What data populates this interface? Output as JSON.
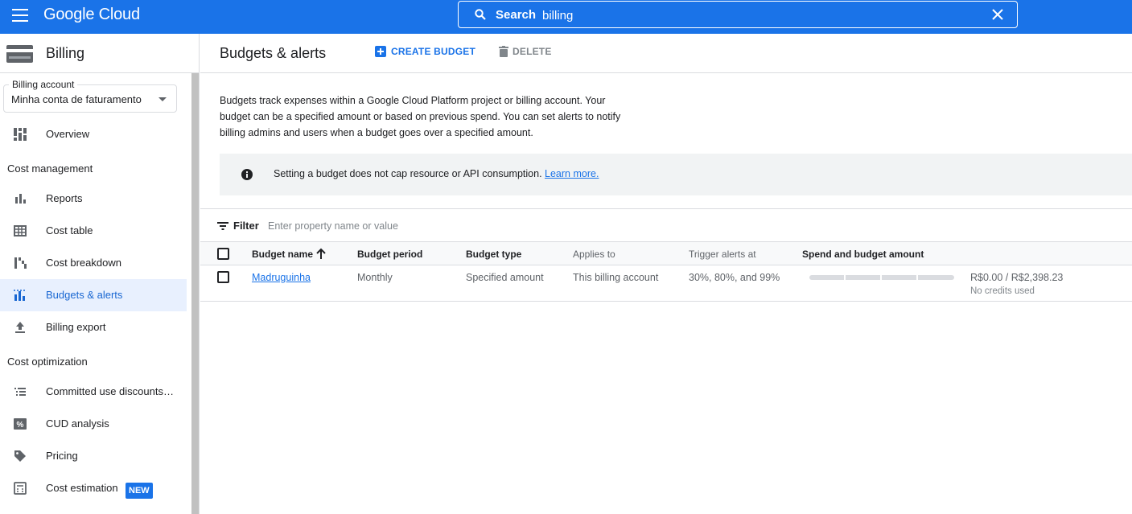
{
  "topbar": {
    "logo": "Google Cloud",
    "search_label": "Search",
    "search_value": "billing"
  },
  "sidebar": {
    "title": "Billing",
    "billing_account": {
      "legend": "Billing account",
      "value": "Minha conta de faturamento"
    },
    "overview": "Overview",
    "sections": {
      "cost_management": "Cost management",
      "cost_optimization": "Cost optimization"
    },
    "items": {
      "reports": "Reports",
      "cost_table": "Cost table",
      "cost_breakdown": "Cost breakdown",
      "budgets_alerts": "Budgets & alerts",
      "billing_export": "Billing export",
      "committed_use": "Committed use discounts…",
      "cud_analysis": "CUD analysis",
      "pricing": "Pricing",
      "cost_estimation": "Cost estimation"
    },
    "new_badge": "NEW",
    "active_item": "Budgets & alerts"
  },
  "main": {
    "title": "Budgets & alerts",
    "create_button": "CREATE BUDGET",
    "delete_button": "DELETE",
    "description": "Budgets track expenses within a Google Cloud Platform project or billing account. Your budget can be a specified amount or based on previous spend. You can set alerts to notify billing admins and users when a budget goes over a specified amount.",
    "notice": {
      "text": "Setting a budget does not cap resource or API consumption.",
      "link": "Learn more."
    },
    "filter": {
      "label": "Filter",
      "placeholder": "Enter property name or value"
    },
    "table": {
      "columns": [
        "Budget name",
        "Budget period",
        "Budget type",
        "Applies to",
        "Trigger alerts at",
        "Spend and budget amount"
      ],
      "rows": [
        {
          "name": "Madruguinha",
          "period": "Monthly",
          "type": "Specified amount",
          "applies_to": "This billing account",
          "triggers": "30%, 80%, and 99%",
          "spend_fraction": 0,
          "amount": "R$0.00 / R$2,398.23",
          "credits": "No credits used"
        }
      ]
    }
  },
  "colors": {
    "brand": "#1a73e8",
    "active_bg": "#e8f0fe",
    "active_text": "#1967d2"
  }
}
